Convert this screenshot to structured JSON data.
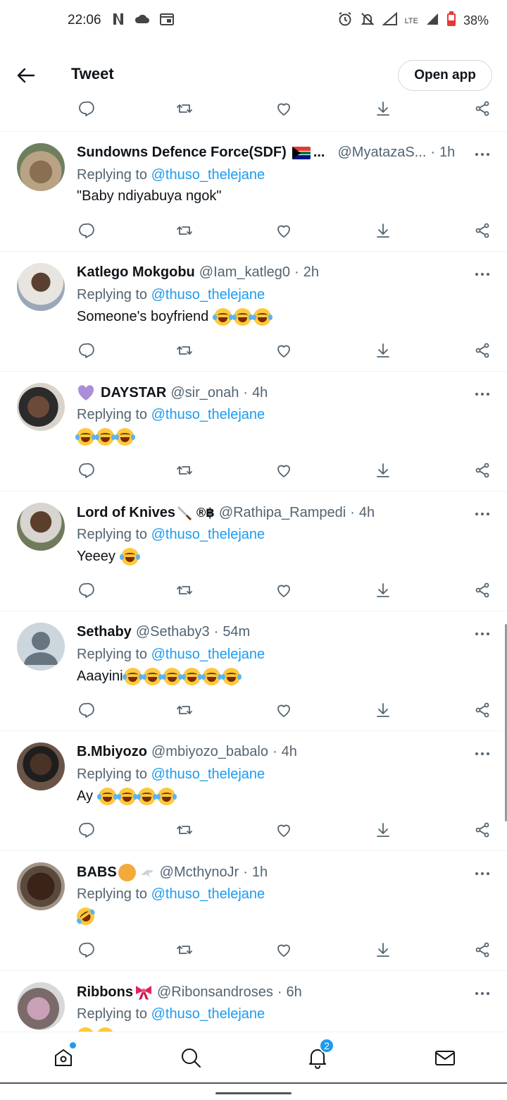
{
  "status_bar": {
    "time": "22:06",
    "battery": "38%",
    "network": "LTE"
  },
  "header": {
    "title": "Tweet",
    "open_app_label": "Open app"
  },
  "tweets": [
    {
      "name": "Sundowns Defence Force(SDF)",
      "name_suffix": "...",
      "handle": "@MyatazaS...",
      "time": "1h",
      "reply_prefix": "Replying to",
      "mention": "@thuso_thelejane",
      "text": "\"Baby ndiyabuya ngok\""
    },
    {
      "name": "Katlego Mokgobu",
      "handle": "@Iam_katleg0",
      "time": "2h",
      "reply_prefix": "Replying to",
      "mention": "@thuso_thelejane",
      "text": "Someone's boyfriend"
    },
    {
      "name": "DAYSTAR",
      "handle": "@sir_onah",
      "time": "4h",
      "reply_prefix": "Replying to",
      "mention": "@thuso_thelejane",
      "text": ""
    },
    {
      "name": "Lord of Knives",
      "name_suffix": "®฿",
      "handle": "@Rathipa_Rampedi",
      "time": "4h",
      "reply_prefix": "Replying to",
      "mention": "@thuso_thelejane",
      "text": "Yeeey"
    },
    {
      "name": "Sethaby",
      "handle": "@Sethaby3",
      "time": "54m",
      "reply_prefix": "Replying to",
      "mention": "@thuso_thelejane",
      "text": "Aaayini"
    },
    {
      "name": "B.Mbiyozo",
      "handle": "@mbiyozo_babalo",
      "time": "4h",
      "reply_prefix": "Replying to",
      "mention": "@thuso_thelejane",
      "text": "Ay"
    },
    {
      "name": "BABS",
      "handle": "@McthynoJr",
      "time": "1h",
      "reply_prefix": "Replying to",
      "mention": "@thuso_thelejane",
      "text": ""
    },
    {
      "name": "Ribbons",
      "handle": "@Ribonsandroses",
      "time": "6h",
      "reply_prefix": "Replying to",
      "mention": "@thuso_thelejane",
      "text": ""
    }
  ],
  "nav": {
    "notification_count": "2"
  },
  "colors": {
    "accent": "#1d9bf0",
    "text": "#0f1419",
    "secondary": "#536471"
  }
}
